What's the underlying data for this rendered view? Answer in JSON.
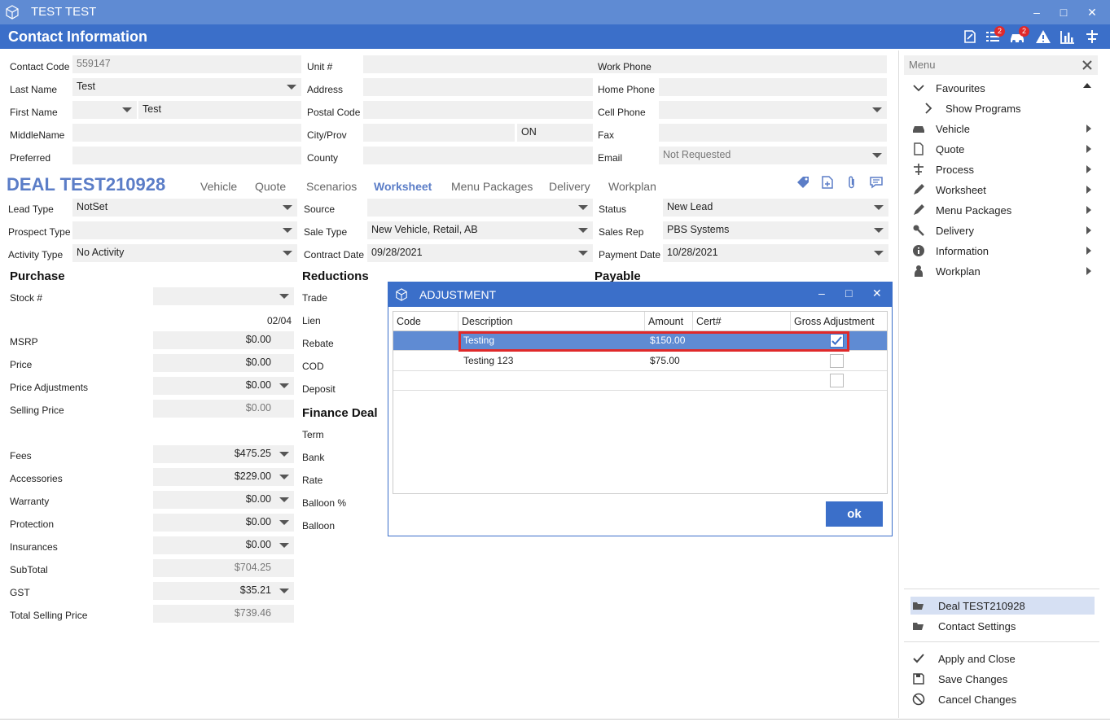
{
  "window": {
    "title": "TEST TEST",
    "minimize": "–",
    "maximize": "□",
    "close": "✕"
  },
  "header": {
    "title": "Contact Information",
    "badge1": "2",
    "badge2": "2"
  },
  "contact": {
    "code_label": "Contact Code",
    "code_value": "559147",
    "last_label": "Last Name",
    "last_value": "Test",
    "first_label": "First Name",
    "first_value": "Test",
    "middle_label": "MiddleName",
    "preferred_label": "Preferred",
    "unit_label": "Unit #",
    "address_label": "Address",
    "postal_label": "Postal Code",
    "city_label": "City/Prov",
    "prov_value": "ON",
    "county_label": "County",
    "work_label": "Work Phone",
    "home_label": "Home Phone",
    "cell_label": "Cell Phone",
    "fax_label": "Fax",
    "email_label": "Email",
    "email_value": "Not Requested"
  },
  "deal": {
    "title": "DEAL TEST210928",
    "tabs": [
      "Vehicle",
      "Quote",
      "Scenarios",
      "Worksheet",
      "Menu Packages",
      "Delivery",
      "Workplan"
    ],
    "lead_label": "Lead Type",
    "lead_value": "NotSet",
    "prospect_label": "Prospect Type",
    "activity_label": "Activity Type",
    "activity_value": "No Activity",
    "source_label": "Source",
    "saletype_label": "Sale Type",
    "saletype_value": "New Vehicle, Retail, AB",
    "contract_label": "Contract Date",
    "contract_value": "09/28/2021",
    "status_label": "Status",
    "status_value": "New Lead",
    "salesrep_label": "Sales Rep",
    "salesrep_value": "PBS Systems",
    "payment_label": "Payment Date",
    "payment_value": "10/28/2021"
  },
  "purchase": {
    "heading": "Purchase",
    "stock_label": "Stock #",
    "stock_sub": "02/04",
    "rows": [
      {
        "label": "MSRP",
        "value": "$0.00"
      },
      {
        "label": "Price",
        "value": "$0.00"
      },
      {
        "label": "Price Adjustments",
        "value": "$0.00"
      },
      {
        "label": "Selling Price",
        "value": "$0.00"
      },
      {
        "label": "Fees",
        "value": "$475.25"
      },
      {
        "label": "Accessories",
        "value": "$229.00"
      },
      {
        "label": "Warranty",
        "value": "$0.00"
      },
      {
        "label": "Protection",
        "value": "$0.00"
      },
      {
        "label": "Insurances",
        "value": "$0.00"
      },
      {
        "label": "SubTotal",
        "value": "$704.25"
      },
      {
        "label": "GST",
        "value": "$35.21"
      },
      {
        "label": "Total Selling Price",
        "value": "$739.46"
      }
    ]
  },
  "reductions": {
    "heading": "Reductions",
    "items": [
      "Trade",
      "Lien",
      "Rebate",
      "COD",
      "Deposit"
    ]
  },
  "finance": {
    "heading": "Finance Deal",
    "items": [
      "Term",
      "Bank",
      "Rate",
      "Balloon %",
      "Balloon"
    ]
  },
  "payable": {
    "heading": "Payable"
  },
  "dialog": {
    "title": "ADJUSTMENT",
    "columns": [
      "Code",
      "Description",
      "Amount",
      "Cert#",
      "Gross Adjustment"
    ],
    "rows": [
      {
        "code": "",
        "description": "Testing",
        "amount": "$150.00",
        "cert": "",
        "gross": true
      },
      {
        "code": "",
        "description": "Testing 123",
        "amount": "$75.00",
        "cert": "",
        "gross": false
      },
      {
        "code": "",
        "description": "",
        "amount": "",
        "cert": "",
        "gross": false
      }
    ],
    "ok_label": "ok"
  },
  "menu": {
    "search_placeholder": "Menu",
    "favourites": "Favourites",
    "show_programs": "Show Programs",
    "items": [
      "Vehicle",
      "Quote",
      "Process",
      "Worksheet",
      "Menu Packages",
      "Delivery",
      "Information",
      "Workplan"
    ],
    "deal_link": "Deal TEST210928",
    "contact_settings": "Contact Settings",
    "apply_close": "Apply and Close",
    "save_changes": "Save Changes",
    "cancel_changes": "Cancel Changes"
  },
  "colors": {
    "accent": "#3b6fc9",
    "titlebar": "#5f8bd3",
    "deal_title": "#5b7dc7",
    "highlight_border": "#e0292a",
    "selected_row": "#5f8bd3"
  }
}
